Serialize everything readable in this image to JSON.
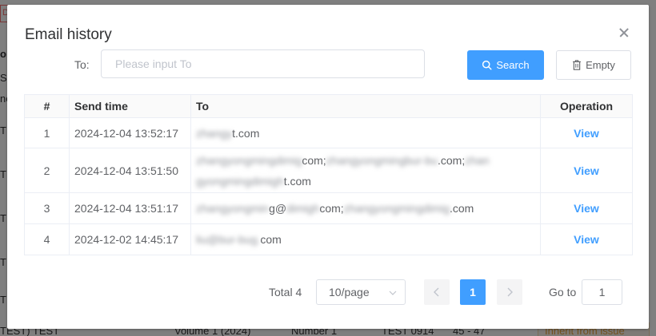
{
  "background": {
    "tag": "De",
    "left_fragments": [
      "o",
      "SD",
      "ne",
      "TE",
      "TE",
      "TE",
      "TE",
      "TE"
    ],
    "bottom_row": [
      "TEST) TEST",
      "Volume 1 (2024)",
      "Number 1",
      "TEST 0914",
      "45 - 47"
    ],
    "badge": "Inherit from issue"
  },
  "dialog": {
    "title": "Email history",
    "search": {
      "label": "To:",
      "placeholder": "Please input To",
      "value": "",
      "search_label": "Search",
      "empty_label": "Empty"
    },
    "table": {
      "columns": [
        "#",
        "Send time",
        "To",
        "Operation"
      ],
      "rows": [
        {
          "index": "1",
          "send_time": "2024-12-04 13:52:17",
          "to_visible": "t.com",
          "action": "View"
        },
        {
          "index": "2",
          "send_time": "2024-12-04 13:51:50",
          "to_visible_1": "com;",
          "to_visible_2": ".com;",
          "to_visible_3": "t.com",
          "action": "View"
        },
        {
          "index": "3",
          "send_time": "2024-12-04 13:51:17",
          "to_visible_1": "g@",
          "to_visible_2": "com;",
          "to_visible_3": ".com",
          "action": "View"
        },
        {
          "index": "4",
          "send_time": "2024-12-02 14:45:17",
          "to_visible": "com",
          "action": "View"
        }
      ]
    },
    "pagination": {
      "total": "Total 4",
      "page_size": "10/page",
      "current_page": "1",
      "goto_label": "Go to",
      "goto_value": "1"
    }
  },
  "colors": {
    "primary": "#409eff",
    "text": "#606266",
    "heading": "#303133",
    "border": "#dcdfe6"
  },
  "icons": [
    "close-icon",
    "search-icon",
    "trash-icon",
    "chevron-down-icon",
    "chevron-left-icon",
    "chevron-right-icon"
  ]
}
